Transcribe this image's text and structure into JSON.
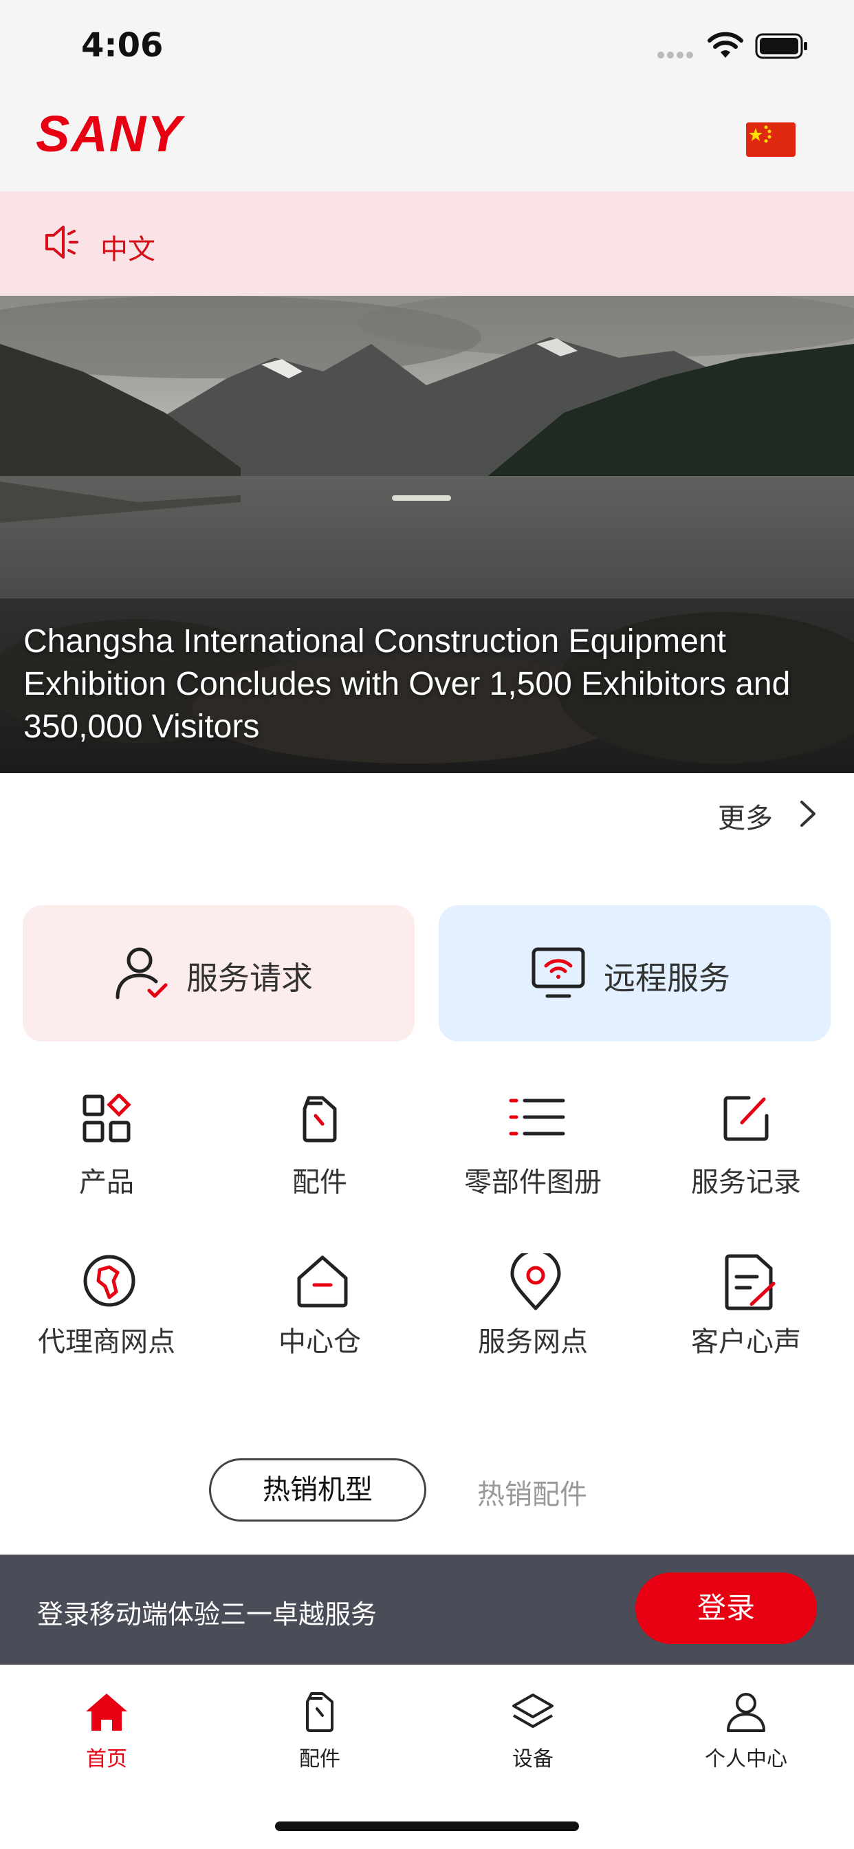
{
  "status_bar": {
    "time": "4:06"
  },
  "header": {
    "logo_text": "SANY",
    "flag": "china-flag-icon"
  },
  "notice": {
    "language": "中文"
  },
  "hero": {
    "title": "Changsha International Construction Equipment Exhibition Concludes with Over 1,500 Exhibitors and 350,000 Visitors"
  },
  "news": {
    "more_label": "更多"
  },
  "cards": [
    {
      "label": "服务请求",
      "icon": "user-check-icon"
    },
    {
      "label": "远程服务",
      "icon": "remote-monitor-icon"
    }
  ],
  "grid": [
    {
      "label": "产品",
      "icon": "grid-apps-icon"
    },
    {
      "label": "配件",
      "icon": "oil-can-icon"
    },
    {
      "label": "零部件图册",
      "icon": "list-icon"
    },
    {
      "label": "服务记录",
      "icon": "edit-square-icon"
    },
    {
      "label": "代理商网点",
      "icon": "globe-icon"
    },
    {
      "label": "中心仓",
      "icon": "warehouse-icon"
    },
    {
      "label": "服务网点",
      "icon": "location-pin-icon"
    },
    {
      "label": "客户心声",
      "icon": "feedback-doc-icon"
    }
  ],
  "product_tabs": {
    "active": "热销机型",
    "inactive": "热销配件"
  },
  "login_banner": {
    "text": "登录移动端体验三一卓越服务",
    "button": "登录"
  },
  "tabbar": [
    {
      "label": "首页",
      "active": true
    },
    {
      "label": "配件",
      "active": false
    },
    {
      "label": "设备",
      "active": false
    },
    {
      "label": "个人中心",
      "active": false
    }
  ],
  "colors": {
    "brand_red": "#e60012",
    "notice_bg": "#f9e3e6",
    "card_red_bg": "#fdecec",
    "card_blue_bg": "#e3f0ff",
    "banner_bg": "#4a4d57"
  }
}
